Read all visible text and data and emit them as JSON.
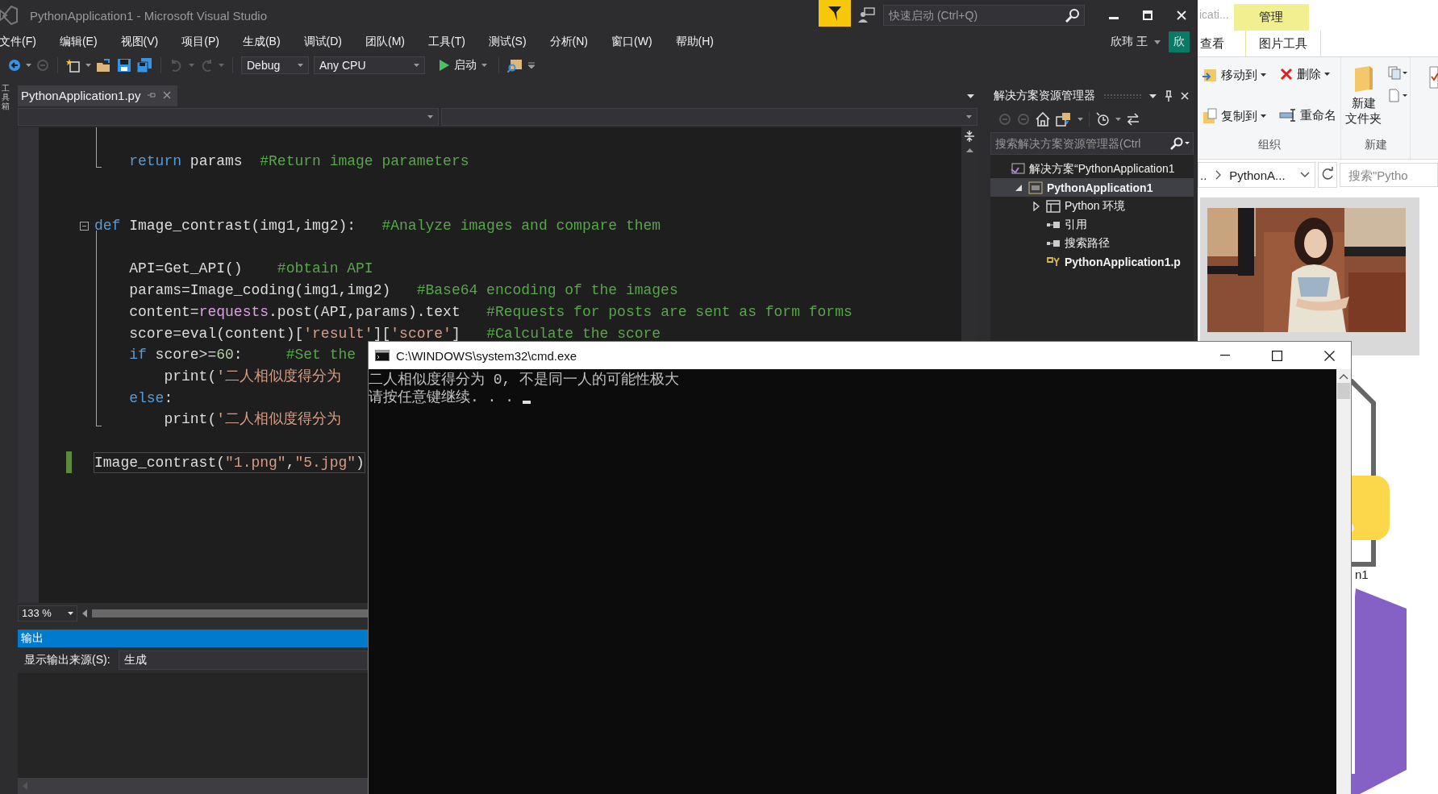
{
  "vs_window": {
    "title": "PythonApplication1 - Microsoft Visual Studio",
    "quick_launch": {
      "placeholder": "快速启动 (Ctrl+Q)"
    },
    "user": {
      "name": "欣玮 王",
      "avatar": "欣"
    },
    "menu": [
      "文件(F)",
      "编辑(E)",
      "视图(V)",
      "项目(P)",
      "生成(B)",
      "调试(D)",
      "团队(M)",
      "工具(T)",
      "测试(S)",
      "分析(N)",
      "窗口(W)",
      "帮助(H)"
    ],
    "toolbar": {
      "configuration": "Debug",
      "platform": "Any CPU",
      "start": "启动"
    },
    "toolbox_tab": "工具箱",
    "document_tab": {
      "label": "PythonApplication1.py",
      "selected": true
    },
    "code": [
      {
        "kind": "block",
        "lines": [
          {
            "kind": "blank"
          },
          {
            "kind": "code",
            "tokens": [
              {
                "kind": "keyword",
                "text": "    return"
              },
              {
                "kind": "plain",
                "text": " params  "
              },
              {
                "kind": "comment",
                "text": "#Return image parameters"
              }
            ]
          }
        ]
      },
      {
        "kind": "blank"
      },
      {
        "kind": "blank"
      },
      {
        "kind": "block",
        "expanded": true,
        "lines": [
          {
            "kind": "code",
            "tokens": [
              {
                "kind": "keyword",
                "text": "def"
              },
              {
                "kind": "plain",
                "text": " Image_contrast(img1,img2):   "
              },
              {
                "kind": "comment",
                "text": "#Analyze images and compare them"
              }
            ]
          },
          {
            "kind": "blank"
          },
          {
            "kind": "code",
            "tokens": [
              {
                "kind": "plain",
                "text": "    API=Get_API()    "
              },
              {
                "kind": "comment",
                "text": "#obtain API"
              }
            ]
          },
          {
            "kind": "code",
            "tokens": [
              {
                "kind": "plain",
                "text": "    params=Image_coding(img1,img2)   "
              },
              {
                "kind": "comment",
                "text": "#Base64 encoding of the images"
              }
            ]
          },
          {
            "kind": "code",
            "tokens": [
              {
                "kind": "plain",
                "text": "    content="
              },
              {
                "kind": "module",
                "text": "requests"
              },
              {
                "kind": "plain",
                "text": ".post(API,params).text   "
              },
              {
                "kind": "comment",
                "text": "#Requests for posts are sent as form forms"
              }
            ]
          },
          {
            "kind": "code",
            "tokens": [
              {
                "kind": "plain",
                "text": "    score=eval(content)["
              },
              {
                "kind": "string",
                "text": "'result'"
              },
              {
                "kind": "plain",
                "text": "]["
              },
              {
                "kind": "string",
                "text": "'score'"
              },
              {
                "kind": "plain",
                "text": "]   "
              },
              {
                "kind": "comment",
                "text": "#Calculate the score"
              }
            ]
          },
          {
            "kind": "code",
            "tokens": [
              {
                "kind": "keyword",
                "text": "    if"
              },
              {
                "kind": "plain",
                "text": " score>="
              },
              {
                "kind": "number",
                "text": "60"
              },
              {
                "kind": "plain",
                "text": ":     "
              },
              {
                "kind": "comment",
                "text": "#Set the"
              }
            ]
          },
          {
            "kind": "code",
            "tokens": [
              {
                "kind": "plain",
                "text": "        print("
              },
              {
                "kind": "string",
                "text": "'二人相似度得分为"
              }
            ]
          },
          {
            "kind": "code",
            "tokens": [
              {
                "kind": "keyword",
                "text": "    else"
              },
              {
                "kind": "plain",
                "text": ":"
              }
            ]
          },
          {
            "kind": "code",
            "tokens": [
              {
                "kind": "plain",
                "text": "        print("
              },
              {
                "kind": "string",
                "text": "'二人相似度得分为"
              }
            ]
          }
        ]
      },
      {
        "kind": "blank"
      },
      {
        "kind": "code",
        "tokens": [
          {
            "kind": "plain",
            "text": "Image_contrast("
          },
          {
            "kind": "string",
            "text": "\"1.png\""
          },
          {
            "kind": "plain",
            "text": ","
          },
          {
            "kind": "string",
            "text": "\"5.jpg\""
          },
          {
            "kind": "plain",
            "text": ")"
          }
        ],
        "current": true,
        "changed": true
      }
    ],
    "zoom": "133 %",
    "output": {
      "title": "输出",
      "source_label": "显示输出来源(S):",
      "source": "生成"
    },
    "solution_explorer": {
      "title": "解决方案资源管理器",
      "search": {
        "placeholder": "搜索解决方案资源管理器(Ctrl"
      },
      "tree": [
        {
          "label": "解决方案“PythonApplication1",
          "kind": "solution",
          "selected": false,
          "bold": false,
          "children": [
            {
              "label": "PythonApplication1",
              "kind": "project",
              "selected": true,
              "bold": true,
              "expanded": true,
              "children": [
                {
                  "label": "Python 环境",
                  "kind": "environments",
                  "selected": false,
                  "bold": false,
                  "expanded": false
                },
                {
                  "label": "引用",
                  "kind": "references",
                  "selected": false,
                  "bold": false
                },
                {
                  "label": "搜索路径",
                  "kind": "search-paths",
                  "selected": false,
                  "bold": false
                },
                {
                  "label": "PythonApplication1.p",
                  "kind": "file",
                  "selected": false,
                  "bold": true
                }
              ]
            }
          ]
        }
      ]
    }
  },
  "cmd_window": {
    "title": "C:\\WINDOWS\\system32\\cmd.exe",
    "lines": [
      "二人相似度得分为 0, 不是同一人的可能性极大",
      "请按任意键继续. . . "
    ]
  },
  "explorer_window": {
    "title": "icati...",
    "context_tab": "管理",
    "tabs": [
      "查看",
      "图片工具"
    ],
    "groups": [
      {
        "label": "组织",
        "buttons": [
          {
            "label": "移动到",
            "kind": "move",
            "dropdown": true
          },
          {
            "label": "删除",
            "kind": "delete",
            "dropdown": true
          },
          {
            "label": "复制到",
            "kind": "copy",
            "dropdown": true
          },
          {
            "label": "重命名",
            "kind": "rename",
            "dropdown": false
          }
        ]
      },
      {
        "label": "新建",
        "buttons": [
          {
            "label_lines": [
              "新建",
              "文件夹"
            ],
            "kind": "new-folder",
            "dropdown": false
          }
        ]
      }
    ],
    "address": {
      "parent": "..",
      "current": "PythonA..."
    },
    "search": {
      "placeholder": "搜索\"Pytho"
    },
    "files": [
      {
        "kind": "picture"
      },
      {
        "kind": "python",
        "name": "n1"
      },
      {
        "kind": "solution"
      }
    ]
  }
}
